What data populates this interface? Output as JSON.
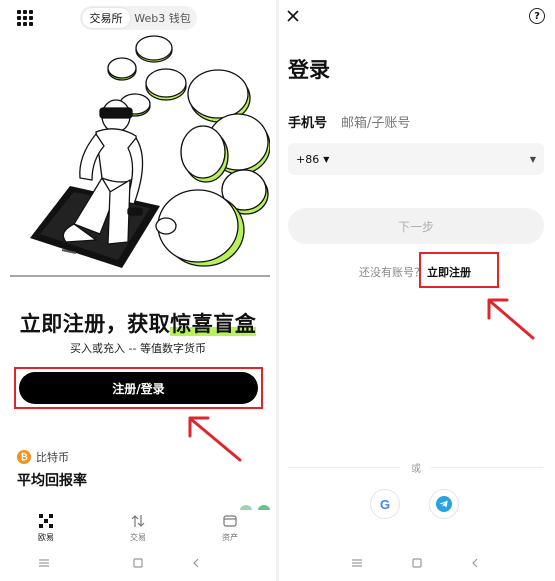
{
  "left": {
    "segment_tabs": [
      {
        "label": "交易所",
        "active": true
      },
      {
        "label": "Web3 钱包",
        "active": false
      }
    ],
    "headline_plain": "立即注册，获取",
    "headline_highlight": "惊喜盲盒",
    "subline": "买入或充入 -- 等值数字货币",
    "register_button": "注册/登录",
    "coin_label": "比特币",
    "coin_symbol": "₿",
    "section_title": "平均回报率",
    "tabs": [
      {
        "label": "欧易",
        "icon": "okx-logo-icon",
        "active": true
      },
      {
        "label": "交易",
        "icon": "trade-arrows-icon",
        "active": false
      },
      {
        "label": "资产",
        "icon": "wallet-icon",
        "active": false
      }
    ]
  },
  "right": {
    "title": "登录",
    "id_tabs": [
      {
        "label": "手机号",
        "active": true
      },
      {
        "label": "邮箱/子账号",
        "active": false
      }
    ],
    "country_code": "+86",
    "phone_value": "",
    "next_button": "下一步",
    "no_account_text": "还没有账号？",
    "register_link": "立即注册",
    "or_text": "或",
    "social": [
      {
        "name": "google-login",
        "icon": "google-icon"
      },
      {
        "name": "telegram-login",
        "icon": "telegram-icon"
      }
    ]
  },
  "colors": {
    "accent_green": "#b8f15a",
    "annotation_red": "#e0262d",
    "primary_black": "#000000",
    "bitcoin_orange": "#f7931a"
  }
}
